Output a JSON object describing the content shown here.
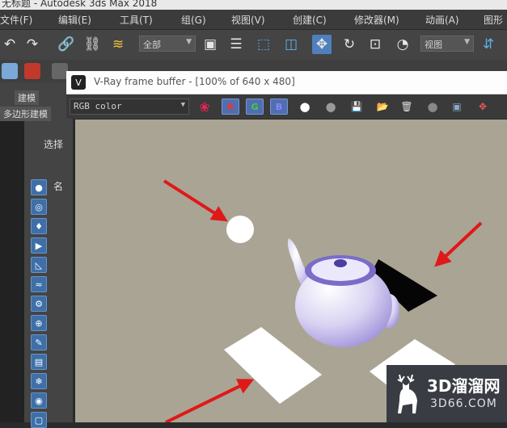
{
  "app": {
    "title": "无标题 - Autodesk 3ds Max 2018"
  },
  "menu": [
    "文件(F)",
    "编辑(E)",
    "工具(T)",
    "组(G)",
    "视图(V)",
    "创建(C)",
    "修改器(M)",
    "动画(A)",
    "图形"
  ],
  "toolbar": {
    "selection_filter": "全部",
    "ref_coord": "视图"
  },
  "panel": {
    "tab_modeling": "建模",
    "tab_poly": "多边形建模",
    "select_label": "选择",
    "name_label": "名"
  },
  "vfb": {
    "title": "V-Ray frame buffer - [100% of 640 x 480]",
    "channel": "RGB color",
    "btn_r": "R",
    "btn_g": "G",
    "btn_b": "B"
  },
  "watermark": {
    "brand": "3D溜溜网",
    "site": "3D66.COM"
  },
  "colors": {
    "accent": "#4f7fbd",
    "render_bg": "#aaa494",
    "arrow": "#e01818"
  }
}
